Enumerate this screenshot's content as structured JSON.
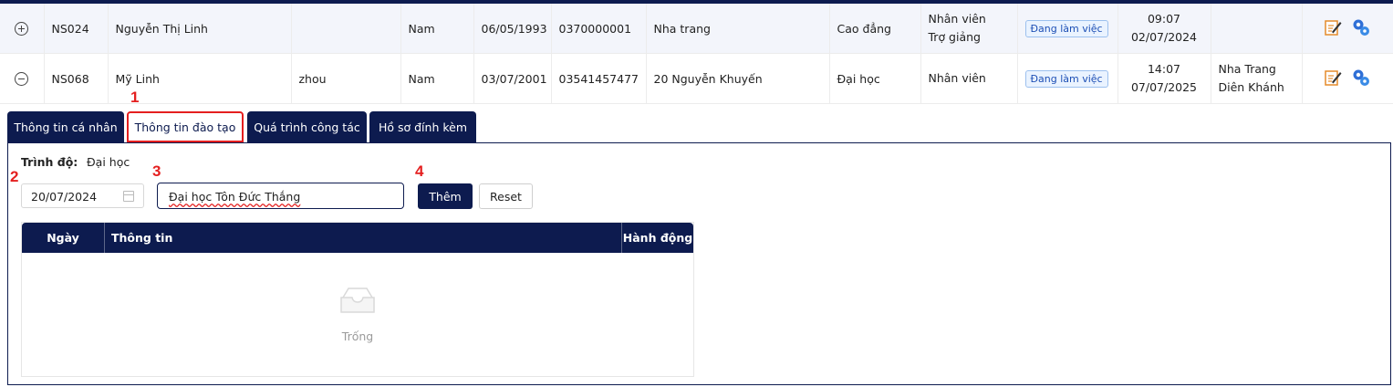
{
  "rows": [
    {
      "expander": "plus",
      "code": "NS024",
      "name": "Nguyễn Thị Linh",
      "alias": "",
      "gender": "Nam",
      "dob": "06/05/1993",
      "phone": "0370000001",
      "address": "Nha trang",
      "education": "Cao đẳng",
      "position_line1": "Nhân viên",
      "position_line2": "Trợ giảng",
      "status": "Đang làm việc",
      "time": "09:07",
      "date": "02/07/2024",
      "location_line1": "",
      "location_line2": ""
    },
    {
      "expander": "minus",
      "code": "NS068",
      "name": "Mỹ Linh",
      "alias": "zhou",
      "gender": "Nam",
      "dob": "03/07/2001",
      "phone": "03541457477",
      "address": "20 Nguyễn Khuyến",
      "education": "Đại học",
      "position_line1": "Nhân viên",
      "position_line2": "",
      "status": "Đang làm việc",
      "time": "14:07",
      "date": "07/07/2025",
      "location_line1": "Nha Trang",
      "location_line2": "Diên Khánh"
    }
  ],
  "tabs": [
    {
      "label": "Thông tin cá nhân"
    },
    {
      "label": "Thông tin đào tạo"
    },
    {
      "label": "Quá trình công tác"
    },
    {
      "label": "Hồ sơ đính kèm"
    }
  ],
  "annotations": {
    "m1": "1",
    "m2": "2",
    "m3": "3",
    "m4": "4"
  },
  "education_panel": {
    "level_label": "Trình độ:",
    "level_value": "Đại học",
    "date_value": "20/07/2024",
    "info_value": "Đại học Tôn Đức Thắng",
    "add_label": "Thêm",
    "reset_label": "Reset",
    "columns": [
      "Ngày",
      "Thông tin",
      "Hành động"
    ],
    "empty_text": "Trống"
  },
  "icons": {
    "edit": "edit-icon",
    "settings": "user-settings-icon",
    "calendar": "calendar-icon",
    "empty": "empty-inbox-icon"
  },
  "colors": {
    "primary": "#0d1b4f",
    "highlight": "#e41f1f",
    "badge": "#1d4fb5"
  }
}
